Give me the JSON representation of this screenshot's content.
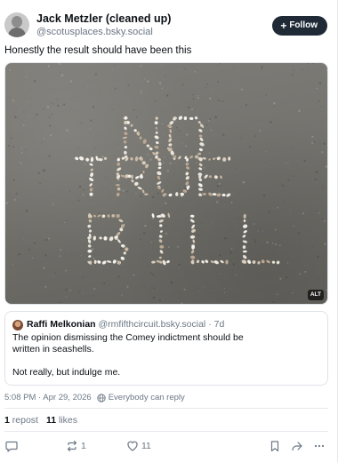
{
  "post": {
    "author": {
      "display_name": "Jack Metzler (cleaned up)",
      "handle": "@scotusplaces.bsky.social"
    },
    "follow_label": "Follow",
    "text": "Honestly the result should have been this",
    "image": {
      "alt_badge": "ALT",
      "sand_text_lines": [
        "NO",
        "TRUE",
        "BILL"
      ]
    },
    "quote": {
      "author_name": "Raffi Melkonian",
      "author_handle": "@rmfifthcircuit.bsky.social",
      "separator": "·",
      "age": "7d",
      "text_line1": "The opinion dismissing the Comey indictment should be",
      "text_line2": "written in seashells.",
      "text_line3": "Not really, but indulge me."
    },
    "timestamp": "5:08 PM · Apr 29, 2026",
    "reply_permission": "Everybody can reply",
    "stats": {
      "reposts_count": "1",
      "reposts_label": "repost",
      "likes_count": "11",
      "likes_label": "likes"
    },
    "actions": {
      "repost_count": "1",
      "like_count": "11"
    }
  },
  "colors": {
    "text_primary": "#0b0f14",
    "text_secondary": "#6b7785",
    "follow_button_bg": "#1f2a36",
    "border": "#dfe3e8"
  },
  "icons": [
    "reply-icon",
    "repost-icon",
    "heart-icon",
    "bookmark-icon",
    "share-icon",
    "more-icon",
    "globe-icon",
    "plus-icon"
  ]
}
